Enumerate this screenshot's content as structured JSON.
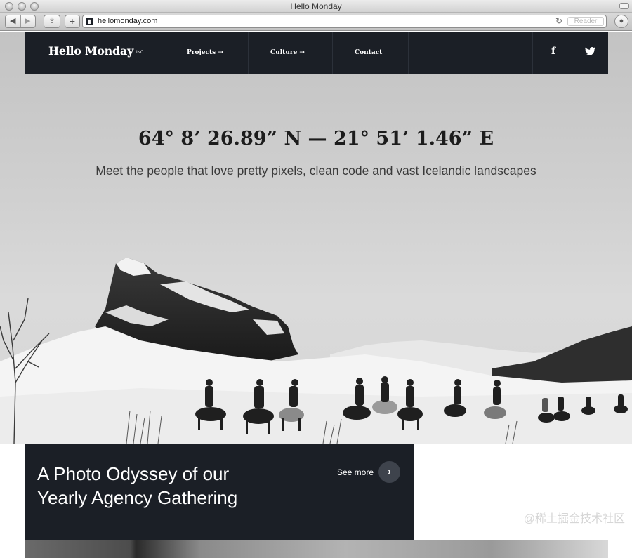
{
  "browser": {
    "window_title": "Hello Monday",
    "url": "hellomonday.com",
    "reader_label": "Reader",
    "back_icon": "back-arrow-icon",
    "forward_icon": "forward-arrow-icon",
    "share_icon": "share-icon",
    "add_icon": "plus-icon",
    "reload_icon": "reload-icon",
    "downloads_icon": "downloads-icon"
  },
  "nav": {
    "logo": "Hello Monday",
    "logo_suffix": "INC",
    "items": [
      {
        "label": "Projects →"
      },
      {
        "label": "Culture →"
      },
      {
        "label": "Contact"
      }
    ],
    "social": [
      {
        "icon": "facebook-icon",
        "glyph": "f"
      },
      {
        "icon": "twitter-icon",
        "glyph": "🐦"
      }
    ]
  },
  "hero": {
    "coordinates": "64° 8’ 26.89” N — 21° 51’ 1.46” E",
    "tagline": "Meet the people that love pretty pixels, clean code and vast Icelandic landscapes"
  },
  "feature": {
    "title_line1": "A Photo Odyssey of our",
    "title_line2": "Yearly Agency Gathering",
    "see_more": "See more",
    "see_more_glyph": "›"
  },
  "watermark": "@稀土掘金技术社区",
  "colors": {
    "nav_bg": "#1b1f26",
    "page_bg": "#ffffff"
  }
}
